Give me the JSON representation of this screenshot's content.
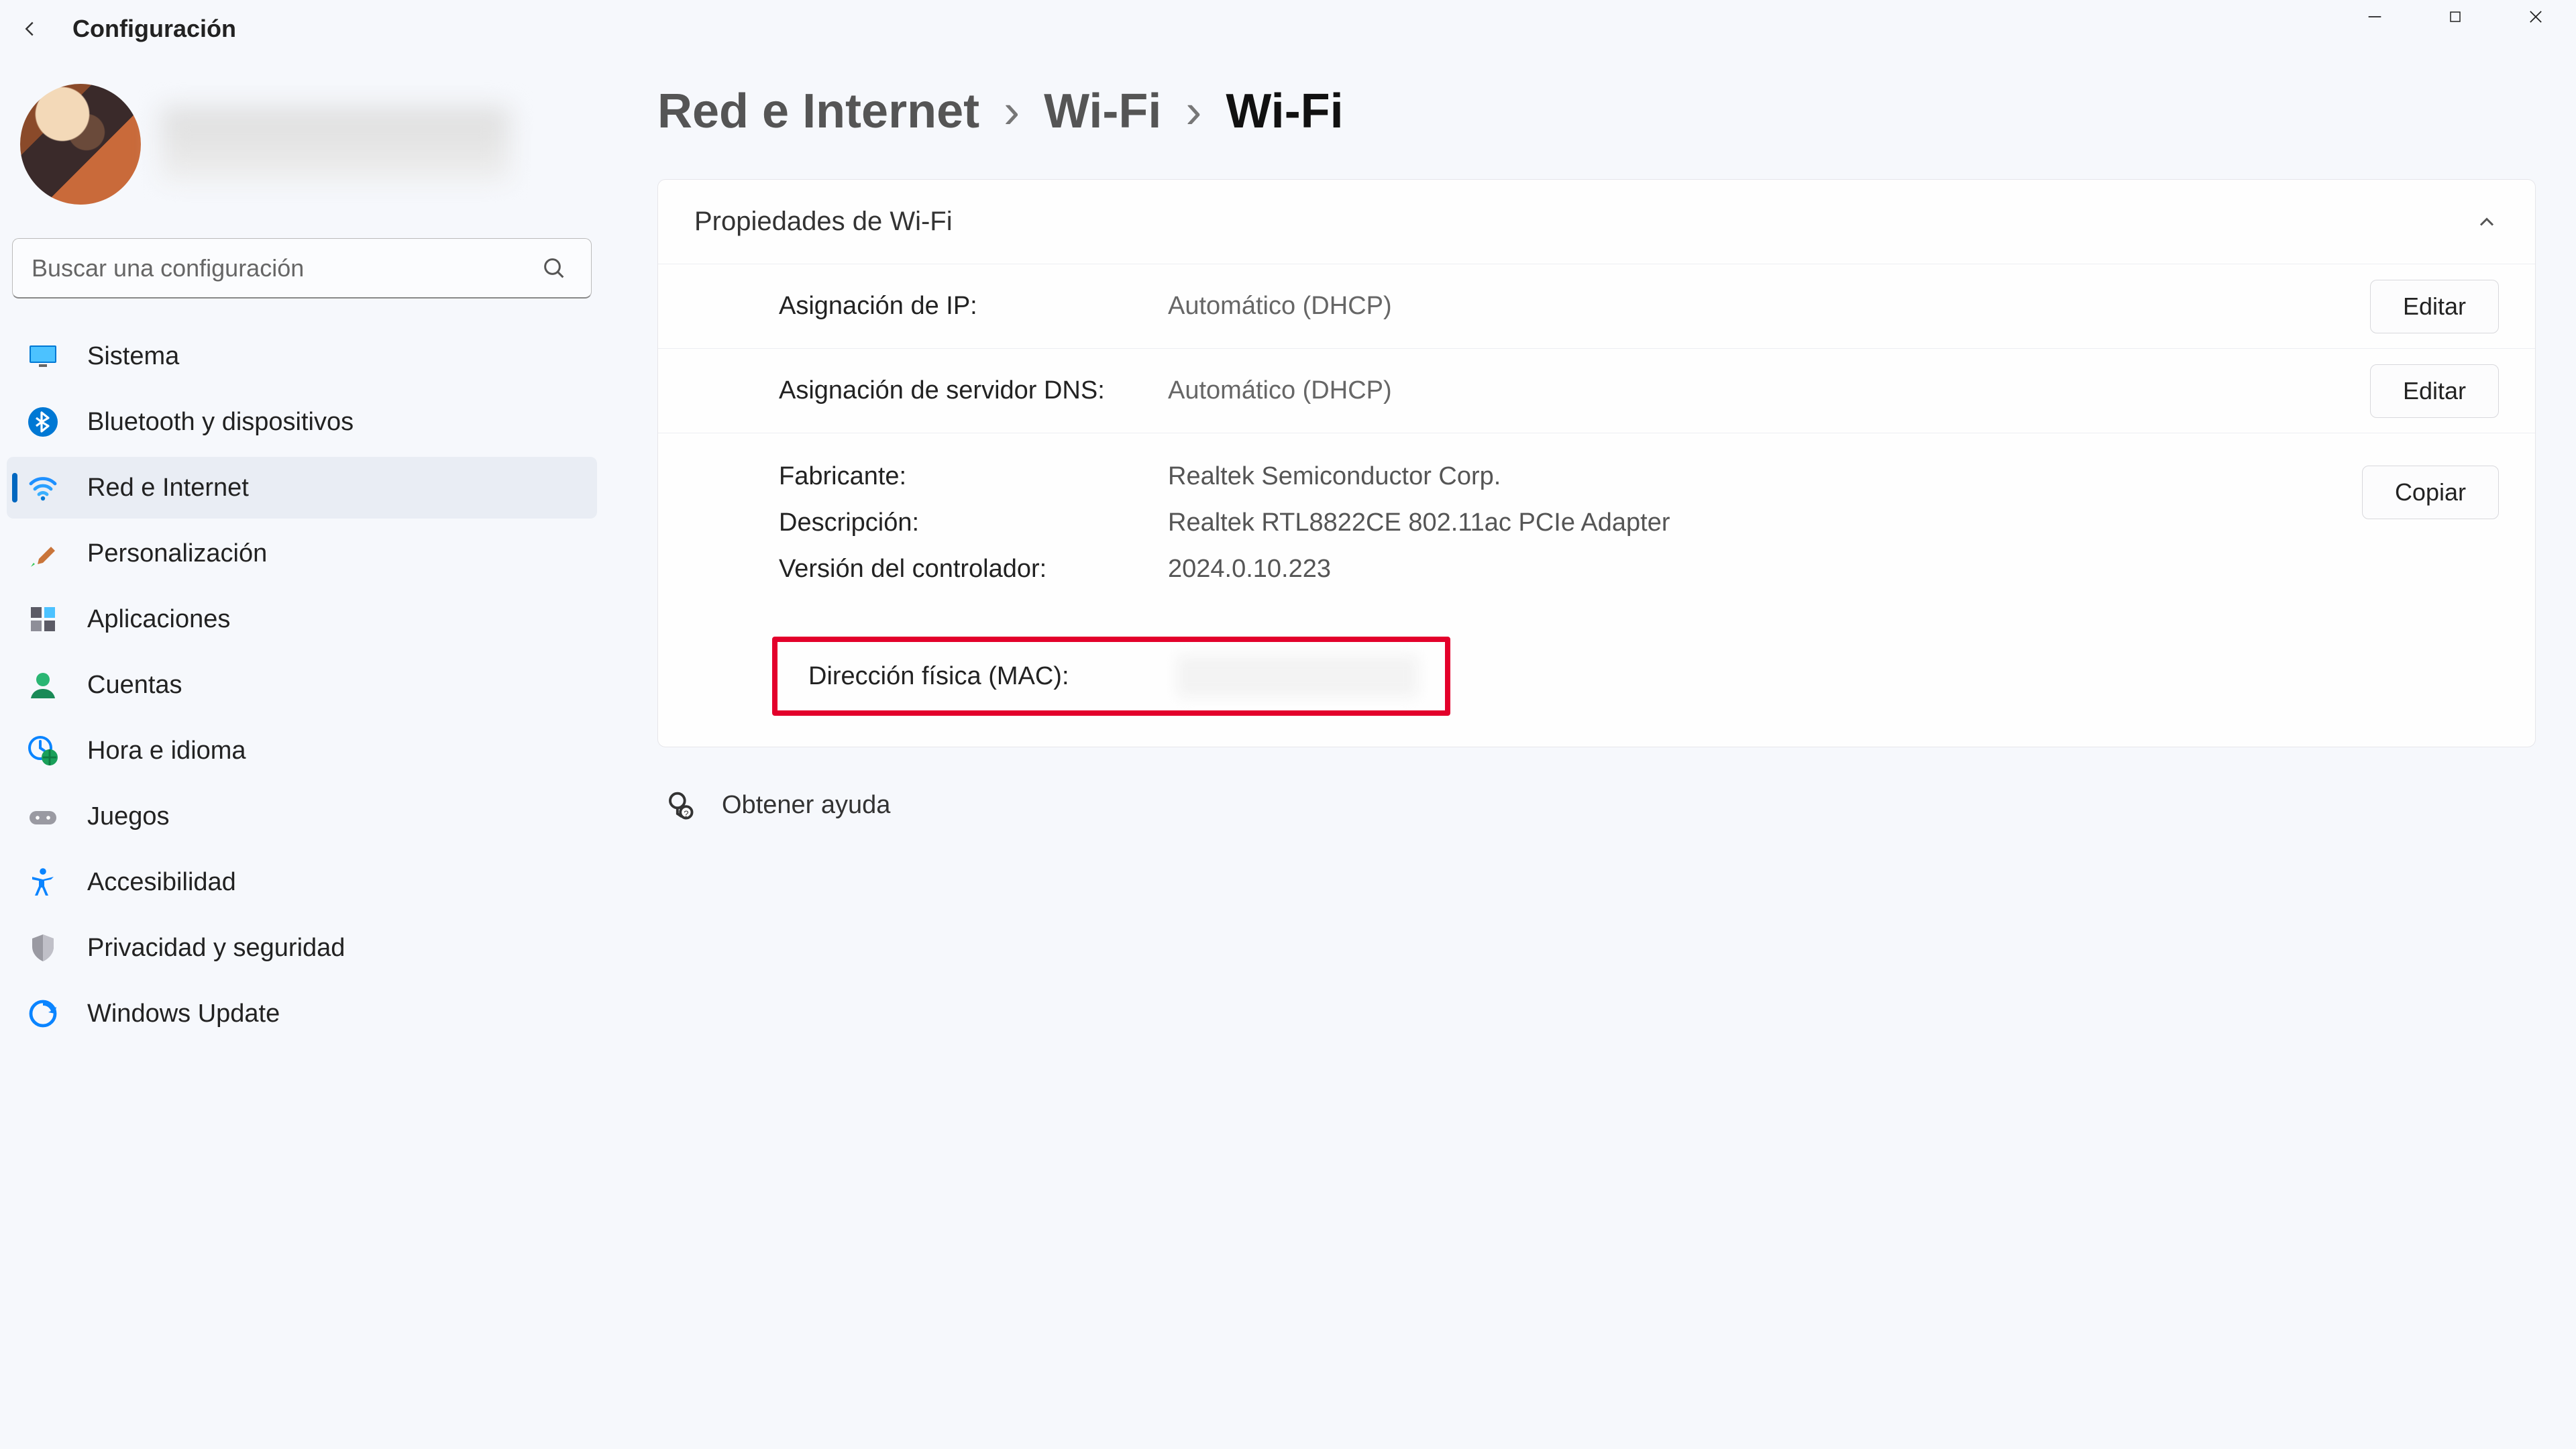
{
  "window": {
    "title": "Configuración"
  },
  "search": {
    "placeholder": "Buscar una configuración"
  },
  "sidebar": {
    "items": [
      {
        "label": "Sistema",
        "icon": "monitor-icon"
      },
      {
        "label": "Bluetooth y dispositivos",
        "icon": "bluetooth-icon"
      },
      {
        "label": "Red e Internet",
        "icon": "wifi-icon",
        "active": true
      },
      {
        "label": "Personalización",
        "icon": "brush-icon"
      },
      {
        "label": "Aplicaciones",
        "icon": "apps-icon"
      },
      {
        "label": "Cuentas",
        "icon": "person-icon"
      },
      {
        "label": "Hora e idioma",
        "icon": "clock-globe-icon"
      },
      {
        "label": "Juegos",
        "icon": "gamepad-icon"
      },
      {
        "label": "Accesibilidad",
        "icon": "accessibility-icon"
      },
      {
        "label": "Privacidad y seguridad",
        "icon": "shield-icon"
      },
      {
        "label": "Windows Update",
        "icon": "update-icon"
      }
    ]
  },
  "breadcrumb": {
    "parts": [
      "Red e Internet",
      "Wi-Fi",
      "Wi-Fi"
    ]
  },
  "panel": {
    "title": "Propiedades de Wi-Fi",
    "edit_label": "Editar",
    "copy_label": "Copiar",
    "ip_assignment": {
      "label": "Asignación de IP:",
      "value": "Automático (DHCP)"
    },
    "dns_assignment": {
      "label": "Asignación de servidor DNS:",
      "value": "Automático (DHCP)"
    },
    "manufacturer": {
      "label": "Fabricante:",
      "value": "Realtek Semiconductor Corp."
    },
    "description": {
      "label": "Descripción:",
      "value": "Realtek RTL8822CE 802.11ac PCIe Adapter"
    },
    "driver_version": {
      "label": "Versión del controlador:",
      "value": "2024.0.10.223"
    },
    "mac": {
      "label": "Dirección física (MAC):"
    }
  },
  "help": {
    "label": "Obtener ayuda"
  }
}
